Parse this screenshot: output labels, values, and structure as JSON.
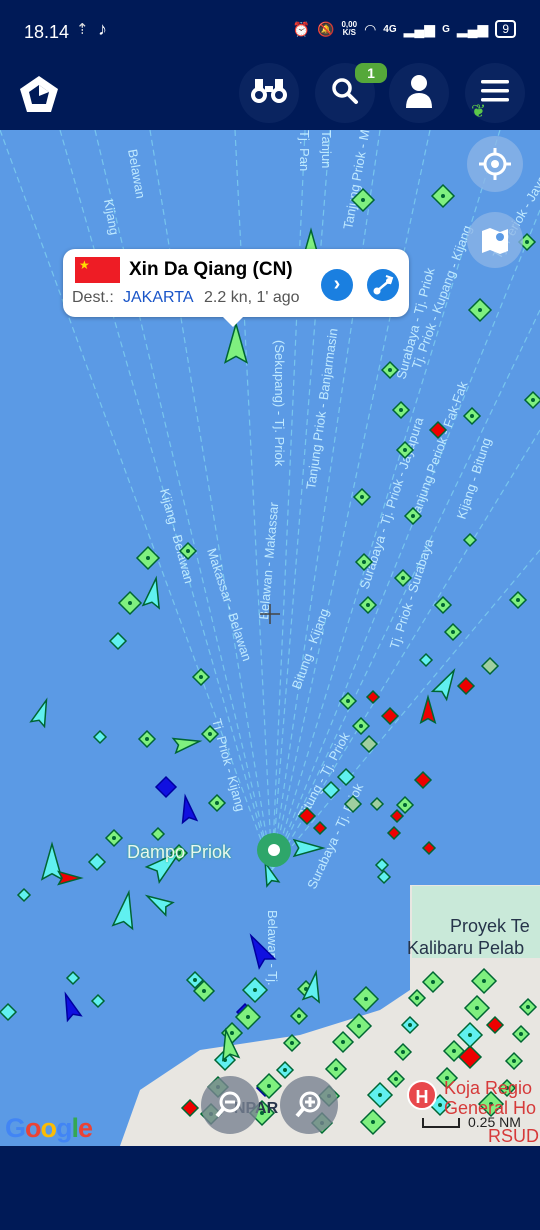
{
  "status": {
    "time": "18.14",
    "net_speed_top": "0,00",
    "net_speed_bottom": "K/S",
    "net_4g": "4G",
    "net_g": "G",
    "battery": "9"
  },
  "nav": {
    "search_badge": "1"
  },
  "popup": {
    "vessel_name": "Xin Da Qiang (CN)",
    "dest_label": "Dest.:",
    "destination": "JAKARTA",
    "speed_info": "2.2 kn, 1' ago",
    "detail_arrow": "›"
  },
  "map": {
    "port_label": "Dampo Priok",
    "area_label_1": "Proyek Te",
    "area_label_2": "Kalibaru Pelab",
    "hospital_label_1": "Koja Regio",
    "hospital_label_2": "General Ho",
    "hospital_label_3": "RSUD",
    "partial_label": "NPAR",
    "scale": "0.25 NM",
    "google": [
      "G",
      "o",
      "o",
      "g",
      "l",
      "e"
    ],
    "route_labels": [
      "Belawan",
      "Kijang",
      "Tj. Pan",
      "Tanjun",
      "Tanjung Priok - Makassar",
      "Kijang - Belawan",
      "(Sekupang) - Tj. Priok",
      "Surabaya - Tj. Priok",
      "Tj. Priok - Kupang - Kijang",
      "Tanjung Priok - Banjarmasin",
      "Kijang - Bitung",
      "Makassar - Belawan",
      "Belawan - Makassar",
      "Surabaya - Tj. Priok - Jayapura",
      "Tanjung Periok - Fak-Fak",
      "Tj. Priok - Surabaya",
      "Tj. Periok - Jayapura",
      "Tj. Priok - Kijang",
      "Bitung - Kijang",
      "Bitung - Tj. Priok",
      "Surabaya - Tj. Priok",
      "Belawan - Tj."
    ],
    "colors": {
      "map_water": "#5b9ae5",
      "land": "#e8e6e1",
      "vessel_green": "#7ff07f",
      "vessel_cyan": "#60f0f0",
      "vessel_red": "#ee0000",
      "vessel_blue": "#1010e0",
      "nav_bg": "#001a57"
    }
  }
}
